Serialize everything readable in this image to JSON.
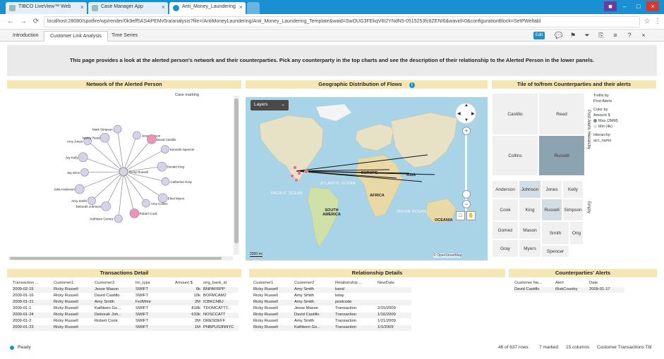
{
  "browser": {
    "tabs": [
      {
        "label": "TIBCO LiveView™ Web"
      },
      {
        "label": "Case Manager App"
      },
      {
        "label": "Anti_Money_Laundering"
      }
    ],
    "url": "localhost:28080/spotfire/wp/render/0k9eff5AS4iPEMv5ra/analysis?file=/AntiMoneyLaundering/Anti_Money_Laundering_Template&waid=SwOUG3FEkqV8I2YNdN5-0515253fc8ZENI6&wavid=0&configurationBlock=SetPWeltabl"
  },
  "app": {
    "page_tabs": [
      "Introduction",
      "Customer Link Analysis",
      "Time Series"
    ],
    "edit_label": "Edit",
    "banner": "This page provides a look at the alerted person's network and their counterparties. Pick any counterparty in the top charts and see the description of their relationship to the Alerted Person in the lower panels."
  },
  "network": {
    "title": "Network of the Alerted Person",
    "case_label": "Case marking",
    "center": "Ricky Russell",
    "nodes": [
      {
        "label": "Jesse Mason"
      },
      {
        "label": "David Castillo"
      },
      {
        "label": "Kenneth Spencer"
      },
      {
        "label": "Donald King"
      },
      {
        "label": "Catherine Gray"
      },
      {
        "label": "Ethel Myers"
      },
      {
        "label": "Amy Collins"
      },
      {
        "label": "Robert Cook"
      },
      {
        "label": "Kathleen Gomez"
      },
      {
        "label": "Deborah Johnson"
      },
      {
        "label": "Amy Smith"
      },
      {
        "label": "Julia Anderson"
      },
      {
        "label": "Jay Sims"
      },
      {
        "label": "Joy Kelly"
      },
      {
        "label": "Amy Jones"
      },
      {
        "label": "Nancy Reed"
      },
      {
        "label": "Mark Simpson"
      }
    ]
  },
  "map": {
    "title": "Geographic Distribution of Flows",
    "layers_label": "Layers",
    "labels": [
      "EUROPE",
      "ASIA",
      "AFRICA",
      "SOUTH AMERICA",
      "OCEANIA"
    ],
    "oceans": [
      "PACIFIC OCEAN",
      "ATLANTIC OCEAN",
      "INDIAN OCEAN"
    ],
    "scale": "2000 mi",
    "attribution": "© OpenStreetMap"
  },
  "treemap": {
    "title": "Tile of to/from Counterparties and their alerts",
    "top_cells": [
      "Castillo",
      "Reed",
      "Collins",
      "Russell"
    ],
    "bottom_cells": [
      "Anderson",
      "Johnson",
      "Jones",
      "Kelly",
      "Cook",
      "King",
      "Russell",
      "Simpson",
      "Gomez",
      "Mason",
      "Smith",
      "Orig",
      "Gray",
      "Myers",
      "Spencer"
    ],
    "top_side_label": "Post Alerts Hierarchy",
    "bottom_side_label": "Empty",
    "legend": {
      "tiles_by": "Trellis by",
      "tiles_val": "Post Alerts",
      "color_by": "Color by",
      "color_val": "Amount $",
      "max_label": "Max (2MM)",
      "min_label": "Min (4k)",
      "hierarchy": "Hierarchy:",
      "hierarchy_val": "acc_name",
      "max_color": "#6f8a9a",
      "min_color": "#dddddd"
    }
  },
  "transactions": {
    "title": "Transactions Detail",
    "columns": [
      "Transaction ...",
      "Customer1",
      "Customer2",
      "trn_type",
      "Amount $",
      "orig_bank_id"
    ],
    "rows": [
      [
        "2009-02-15",
        "Ricky Russell",
        "Jesse Mason",
        "SWIFT",
        "6k",
        "BNPAFRPP"
      ],
      [
        "2009-01-16",
        "Ricky Russell",
        "David Castillo",
        "SWIFT",
        "10k",
        "BOFMCAM2"
      ],
      [
        "2009-01-21",
        "Ricky Russell",
        "Amy Smith",
        "FedWire",
        "2M",
        "ICBKCNBJ"
      ],
      [
        "2009-01-1",
        "Ricky Russell",
        "Kathleen Go...",
        "SWIFT",
        "818k",
        "TDOMCATTT..."
      ],
      [
        "2009-01-24",
        "Ricky Russell",
        "Deborah Joh...",
        "SWIFT",
        "633k",
        "NOSCCATT"
      ],
      [
        "2009-01-2",
        "Ricky Russell",
        "Robert Cook",
        "SWIFT",
        "2M",
        "DRESDEFF"
      ],
      [
        "2009-01-23",
        "Ricky Russell",
        "",
        "SWIFT",
        "1M",
        "PNBPUS3NNYC"
      ]
    ]
  },
  "relationship": {
    "title": "Relationship Details",
    "columns": [
      "Customer1",
      "Customer2",
      "Relationship ...",
      "NewDate"
    ],
    "rows": [
      [
        "Ricky Russell",
        "Amy Smith",
        "band",
        ""
      ],
      [
        "Ricky Russell",
        "Amy Smith",
        "bday",
        ""
      ],
      [
        "Ricky Russell",
        "Amy Smith",
        "postcode",
        ""
      ],
      [
        "Ricky Russell",
        "Jesse Mason",
        "Transaction",
        "2/15/2009"
      ],
      [
        "Ricky Russell",
        "David Castillo",
        "Transaction",
        "1/16/2009"
      ],
      [
        "Ricky Russell",
        "Amy Smith",
        "Transaction",
        "1/21/2009"
      ],
      [
        "Ricky Russell",
        "Kathleen Go...",
        "Transaction",
        "1/1/2009"
      ]
    ]
  },
  "alerts": {
    "title": "Counterparties' Alerts",
    "columns": [
      "Customer Na...",
      "Alert",
      "Date"
    ],
    "rows": [
      [
        "David Castillo",
        "RiskCountry",
        "2009-01-17"
      ]
    ]
  },
  "status": {
    "ready": "Ready",
    "rows": "46 of 637 rows",
    "marked": "7 marked",
    "columns": "15 columns",
    "table": "Customer Transactions Tbl"
  }
}
